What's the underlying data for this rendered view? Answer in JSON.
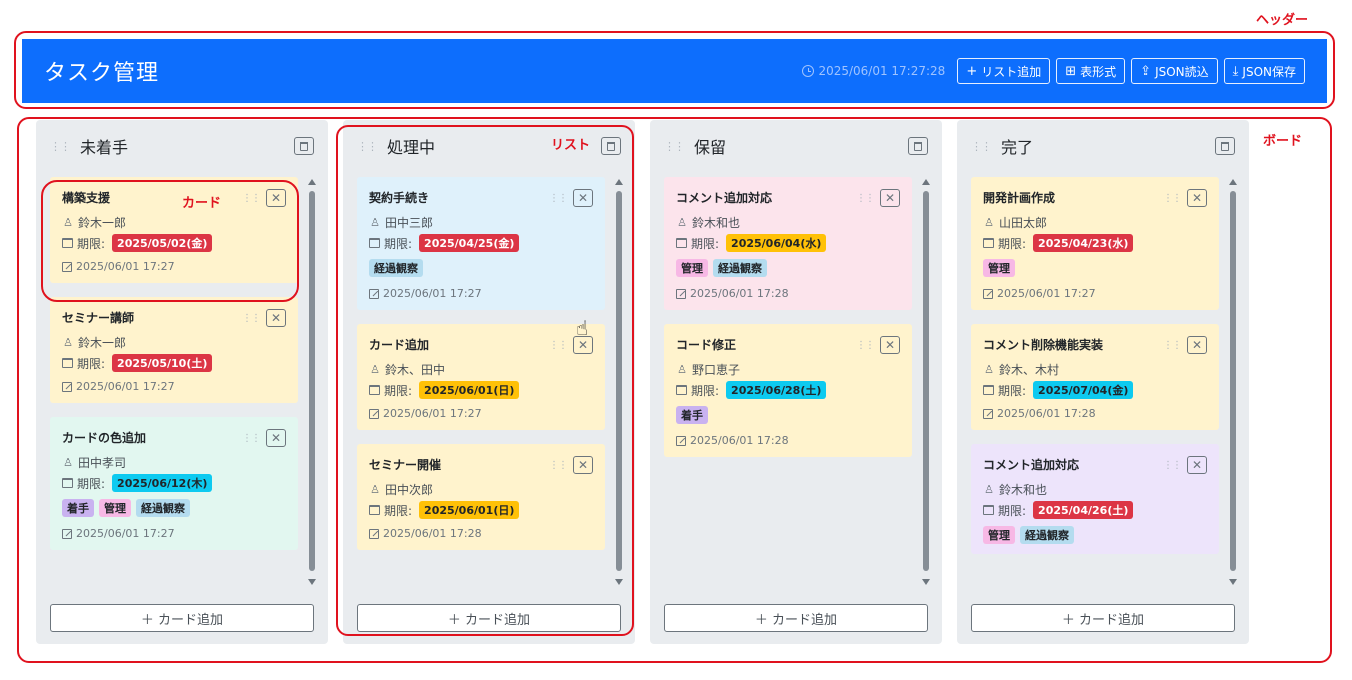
{
  "annotations": {
    "header": "ヘッダー",
    "board": "ボード",
    "list": "リスト",
    "card": "カード"
  },
  "header": {
    "title": "タスク管理",
    "clock": "2025/06/01 17:27:28",
    "buttons": {
      "add_list": "リスト追加",
      "table": "表形式",
      "json_load": "JSON読込",
      "json_save": "JSON保存"
    }
  },
  "labels": {
    "due_prefix": "期限:",
    "add_card": "＋ カード追加"
  },
  "columns": [
    {
      "title": "未着手",
      "cards": [
        {
          "title": "構築支援",
          "assignee": "鈴木一郎",
          "due": "2025/05/02(金)",
          "due_color": "#dc3545",
          "tags": [],
          "updated": "2025/06/01 17:27",
          "color": "#fff3cd"
        },
        {
          "title": "セミナー講師",
          "assignee": "鈴木一郎",
          "due": "2025/05/10(土)",
          "due_color": "#dc3545",
          "tags": [],
          "updated": "2025/06/01 17:27",
          "color": "#fff3cd"
        },
        {
          "title": "カードの色追加",
          "assignee": "田中孝司",
          "due": "2025/06/12(木)",
          "due_color": "#0dcaf0",
          "tags": [
            "着手",
            "管理",
            "経過観察"
          ],
          "updated": "2025/06/01 17:27",
          "color": "#e2f7f0"
        }
      ]
    },
    {
      "title": "処理中",
      "cards": [
        {
          "title": "契約手続き",
          "assignee": "田中三郎",
          "due": "2025/04/25(金)",
          "due_color": "#dc3545",
          "tags": [
            "経過観察"
          ],
          "updated": "2025/06/01 17:27",
          "color": "#dff1fb"
        },
        {
          "title": "カード追加",
          "assignee": "鈴木、田中",
          "due": "2025/06/01(日)",
          "due_color": "#ffc107",
          "tags": [],
          "updated": "2025/06/01 17:27",
          "color": "#fff3cd"
        },
        {
          "title": "セミナー開催",
          "assignee": "田中次郎",
          "due": "2025/06/01(日)",
          "due_color": "#ffc107",
          "tags": [],
          "updated": "2025/06/01 17:28",
          "color": "#fff3cd"
        }
      ]
    },
    {
      "title": "保留",
      "cards": [
        {
          "title": "コメント追加対応",
          "assignee": "鈴木和也",
          "due": "2025/06/04(水)",
          "due_color": "#ffc107",
          "tags": [
            "管理",
            "経過観察"
          ],
          "updated": "2025/06/01 17:28",
          "color": "#fce4ec"
        },
        {
          "title": "コード修正",
          "assignee": "野口恵子",
          "due": "2025/06/28(土)",
          "due_color": "#0dcaf0",
          "tags": [
            "着手"
          ],
          "updated": "2025/06/01 17:28",
          "color": "#fff3cd"
        }
      ]
    },
    {
      "title": "完了",
      "cards": [
        {
          "title": "開発計画作成",
          "assignee": "山田太郎",
          "due": "2025/04/23(水)",
          "due_color": "#dc3545",
          "tags": [
            "管理"
          ],
          "updated": "2025/06/01 17:27",
          "color": "#fff3cd"
        },
        {
          "title": "コメント削除機能実装",
          "assignee": "鈴木、木村",
          "due": "2025/07/04(金)",
          "due_color": "#0dcaf0",
          "tags": [],
          "updated": "2025/06/01 17:28",
          "color": "#fff3cd"
        },
        {
          "title": "コメント追加対応",
          "assignee": "鈴木和也",
          "due": "2025/04/26(土)",
          "due_color": "#dc3545",
          "tags": [
            "管理",
            "経過観察"
          ],
          "updated": "",
          "color": "#ede4fb"
        }
      ]
    }
  ],
  "colors": {
    "header": "#0d6efd",
    "annotation": "#e0121e",
    "tag_管理": "#f7b8e5",
    "tag_経過観察": "#b4dcef",
    "tag_着手": "#c9b2f0"
  }
}
